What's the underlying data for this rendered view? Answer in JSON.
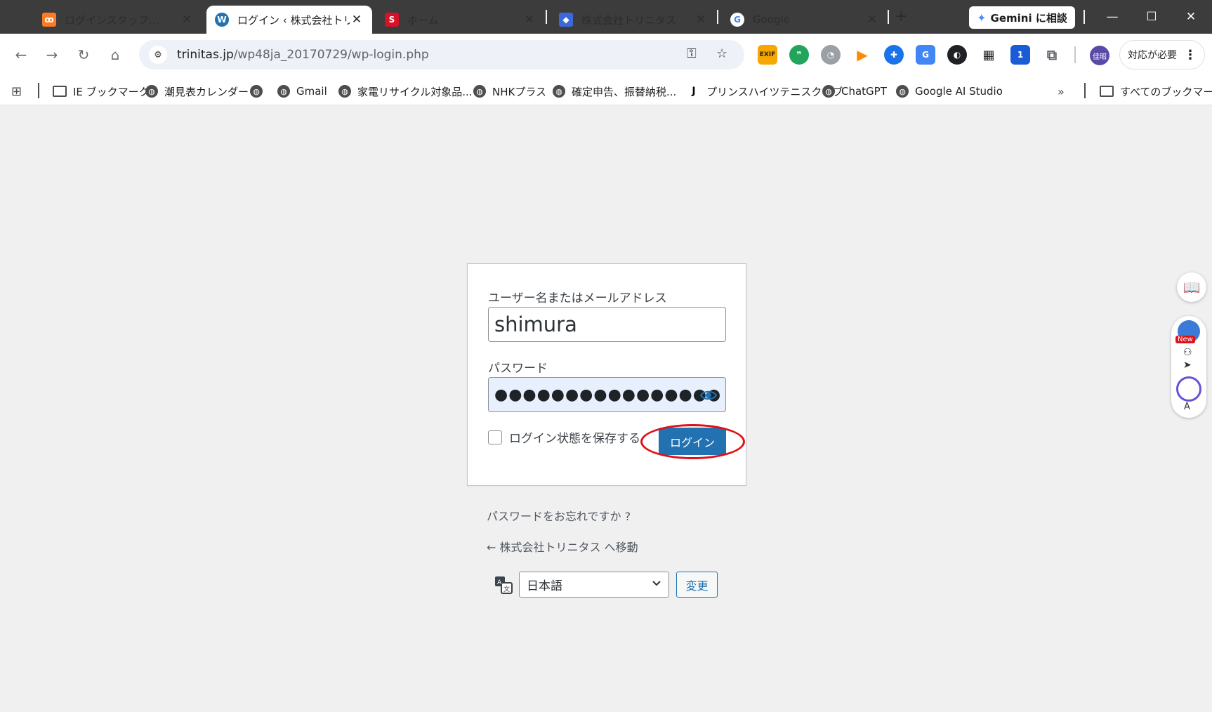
{
  "tabs": [
    {
      "title": "ログインスタッフ…",
      "favicon": "xampp-icon",
      "color": "#fb7a24",
      "glyph": "ꝏ",
      "active": false
    },
    {
      "title": "ログイン ‹ 株式会社トリニ",
      "favicon": "wordpress-icon",
      "color": "#2271b1",
      "glyph": "W",
      "active": true
    },
    {
      "title": "ホーム",
      "favicon": "site-icon",
      "color": "#d6112a",
      "glyph": "S",
      "active": false
    },
    {
      "title": "株式会社トリニタス",
      "favicon": "cube-icon",
      "color": "#3b6ad8",
      "glyph": "◆",
      "active": false
    },
    {
      "title": "Google",
      "favicon": "google-icon",
      "color": "#ffffff",
      "glyph": "G",
      "active": false
    }
  ],
  "gemini": {
    "label": "Gemini に相談"
  },
  "omnibox": {
    "host": "trinitas.jp",
    "path": "/wp48ja_20170729/wp-login.php"
  },
  "toolbar": {
    "action_required": "対応が必要",
    "profile_initials": "佳昭"
  },
  "extensions": [
    {
      "name": "exif-extension-icon",
      "color": "#f6a800",
      "glyph": "EXIF"
    },
    {
      "name": "quote-extension-icon",
      "color": "#22a45d",
      "glyph": "❞"
    },
    {
      "name": "rss-extension-icon",
      "color": "#9aa0a6",
      "glyph": "◔"
    },
    {
      "name": "play-extension-icon",
      "color": "#ff8a00",
      "glyph": "▶"
    },
    {
      "name": "dice-extension-icon",
      "color": "#1a73e8",
      "glyph": "✚"
    },
    {
      "name": "translate-extension-icon",
      "color": "#4285f4",
      "glyph": "G"
    },
    {
      "name": "compass-extension-icon",
      "color": "#202124",
      "glyph": "◐"
    },
    {
      "name": "qr-extension-icon",
      "color": "#ffffff",
      "glyph": "▦"
    },
    {
      "name": "badge-extension-icon",
      "color": "#1a5bd6",
      "glyph": "1"
    }
  ],
  "bookmarks": [
    {
      "label": "IE ブックマーク",
      "type": "folder"
    },
    {
      "label": "潮見表カレンダー",
      "type": "globe"
    },
    {
      "label": "",
      "type": "globe"
    },
    {
      "label": "Gmail",
      "type": "globe"
    },
    {
      "label": "家電リサイクル対象品...",
      "type": "globe"
    },
    {
      "label": "NHKプラス",
      "type": "globe"
    },
    {
      "label": "確定申告、振替納税...",
      "type": "globe"
    },
    {
      "label": "プリンスハイツテニスクラブ",
      "type": "j"
    },
    {
      "label": "ChatGPT",
      "type": "globe"
    },
    {
      "label": "Google AI Studio",
      "type": "globe"
    }
  ],
  "bookmarks_all": "すべてのブックマーク",
  "login": {
    "username_label": "ユーザー名またはメールアドレス",
    "username_value": "shimura",
    "password_label": "パスワード",
    "password_mask": "●●●●●●●●●●●●●●●●",
    "remember_label": "ログイン状態を保存する",
    "submit_label": "ログイン",
    "remember_checked": false
  },
  "links": {
    "lost_password": "パスワードをお忘れですか ?",
    "back_to_site": "← 株式会社トリニタス へ移動"
  },
  "language": {
    "selected": "日本語",
    "change_label": "変更"
  },
  "side_widgets": {
    "new_badge": "New"
  }
}
